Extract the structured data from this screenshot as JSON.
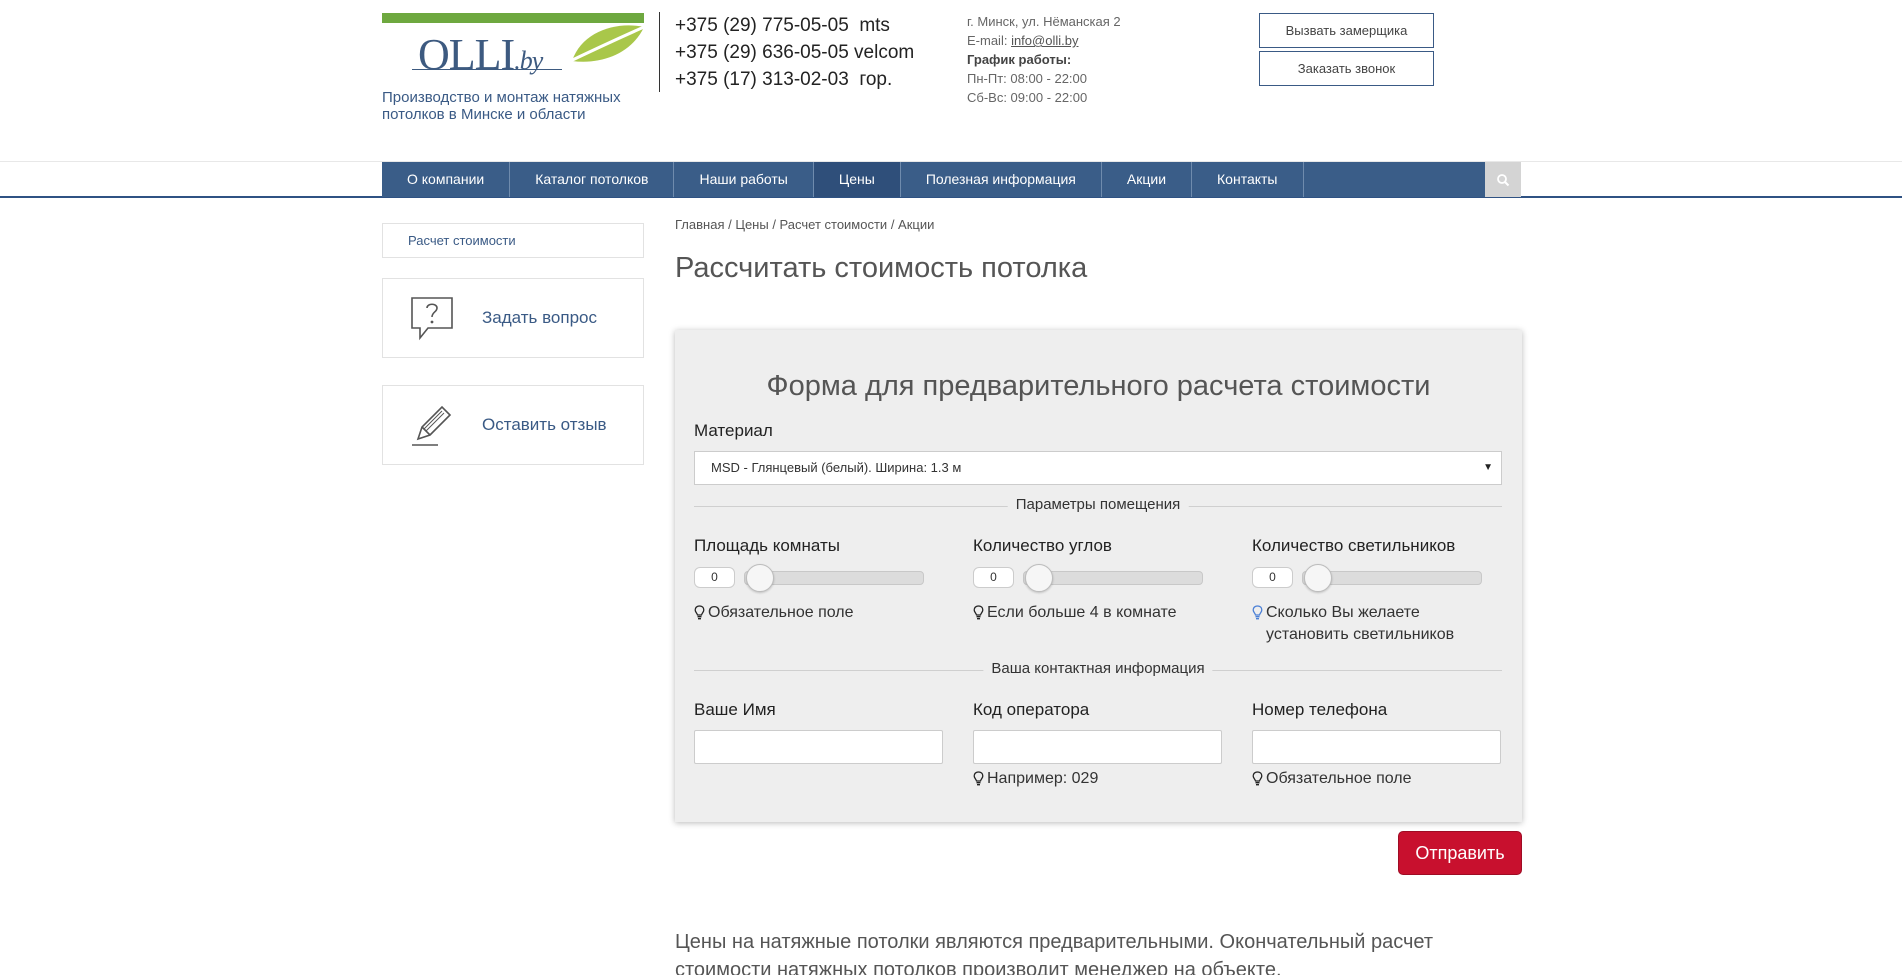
{
  "brand": {
    "logo_main": "OLLI",
    "logo_suffix": ".by",
    "tagline": "Производство и монтаж натяжных потолков в Минске и области",
    "logo_green": "#6ea83f",
    "logo_leaf": "#a9c74a",
    "primary_blue": "#3a5d88"
  },
  "header": {
    "phones": [
      "+375 (29) 775-05-05  mts",
      "+375 (29) 636-05-05 velcom",
      "+375 (17) 313-02-03  гор."
    ],
    "address": "г. Минск, ул. Нёманская 2",
    "email_label": "E-mail: ",
    "email": "info@olli.by",
    "schedule_title": "График работы:",
    "schedule_weekdays": "Пн-Пт: 08:00 - 22:00",
    "schedule_weekend": "Сб-Вс: 09:00 - 22:00",
    "btn_measure": "Вызвать замерщика",
    "btn_call": "Заказать звонок"
  },
  "nav": {
    "items": [
      "О компании",
      "Каталог потолков",
      "Наши работы",
      "Цены",
      "Полезная информация",
      "Акции",
      "Контакты"
    ],
    "active_index": 3,
    "search_icon": "search-icon"
  },
  "sidebar": {
    "link": "Расчет стоимости",
    "ask": "Задать вопрос",
    "review": "Оставить отзыв"
  },
  "breadcrumb": [
    "Главная",
    "Цены",
    "Расчет стоимости",
    "Акции"
  ],
  "page_title": "Рассчитать стоимость потолка",
  "form": {
    "title": "Форма для предварительного расчета стоимости",
    "material_label": "Материал",
    "material_value": "MSD - Глянцевый (белый). Ширина: 1.3 м",
    "section_room": "Параметры помещения",
    "area_label": "Площадь комнаты",
    "area_value": "0",
    "area_hint": "Обязательное поле",
    "corners_label": "Количество углов",
    "corners_value": "0",
    "corners_hint": "Если больше 4 в комнате",
    "lights_label": "Количество светильников",
    "lights_value": "0",
    "lights_hint": "Сколько Вы желаете установить светильников",
    "section_contact": "Ваша контактная информация",
    "name_label": "Ваше Имя",
    "operator_label": "Код оператора",
    "operator_hint": "Например: 029",
    "phone_label": "Номер телефона",
    "phone_hint": "Обязательное поле",
    "submit": "Отправить"
  },
  "notice": "Цены на натяжные потолки являются предварительными. Окончательный расчет стоимости натяжных потолков производит менеджер на объекте."
}
